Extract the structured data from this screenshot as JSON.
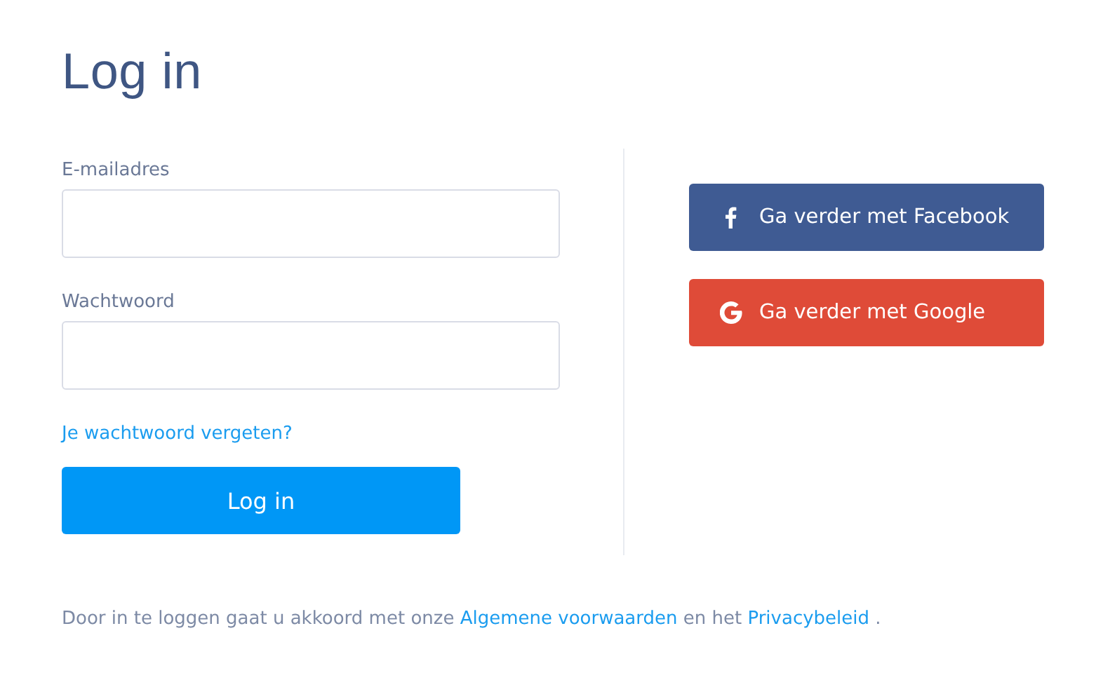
{
  "title": "Log in",
  "fields": [
    {
      "label": "E-mailadres"
    },
    {
      "label": "Wachtwoord"
    }
  ],
  "forgot_link": "Je wachtwoord vergeten?",
  "submit_button": "Log in",
  "social_buttons": [
    {
      "label": "Ga verder met Facebook",
      "kind": "facebook"
    },
    {
      "label": "Ga verder met Google",
      "kind": "google"
    }
  ],
  "footer": [
    {
      "text": "Door in te loggen gaat u akkoord met onze ",
      "kind": "text"
    },
    {
      "text": "Algemene voorwaarden",
      "kind": "link"
    },
    {
      "text": " en het ",
      "kind": "text"
    },
    {
      "text": "Privacybeleid",
      "kind": "link"
    },
    {
      "text": " .",
      "kind": "text"
    }
  ]
}
